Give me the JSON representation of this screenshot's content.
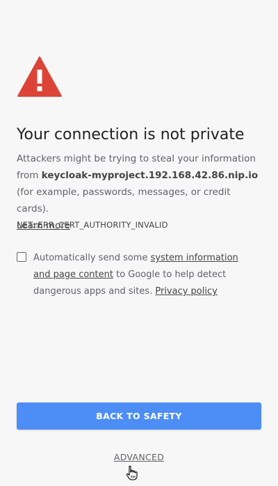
{
  "interstitial": {
    "title": "Your connection is not private",
    "body_pre": "Attackers might be trying to steal your information from ",
    "hostname": "keycloak-myproject.192.168.42.86.nip.io",
    "body_post": " (for example, passwords, messages, or credit cards).",
    "learn_more": "Learn more",
    "error_code": "NET::ERR_CERT_AUTHORITY_INVALID",
    "icon": "warning-triangle-icon",
    "icon_color": "#db4437"
  },
  "optin": {
    "checked": false,
    "text_pre": "Automatically send some ",
    "link1": "system information and page content",
    "text_mid": " to Google to help detect dangerous apps and sites. ",
    "link2": "Privacy policy"
  },
  "buttons": {
    "back_to_safety": "BACK TO SAFETY",
    "advanced": "ADVANCED",
    "primary_color": "#4c8ef5"
  },
  "pointer": {
    "icon": "hand-cursor-icon"
  }
}
